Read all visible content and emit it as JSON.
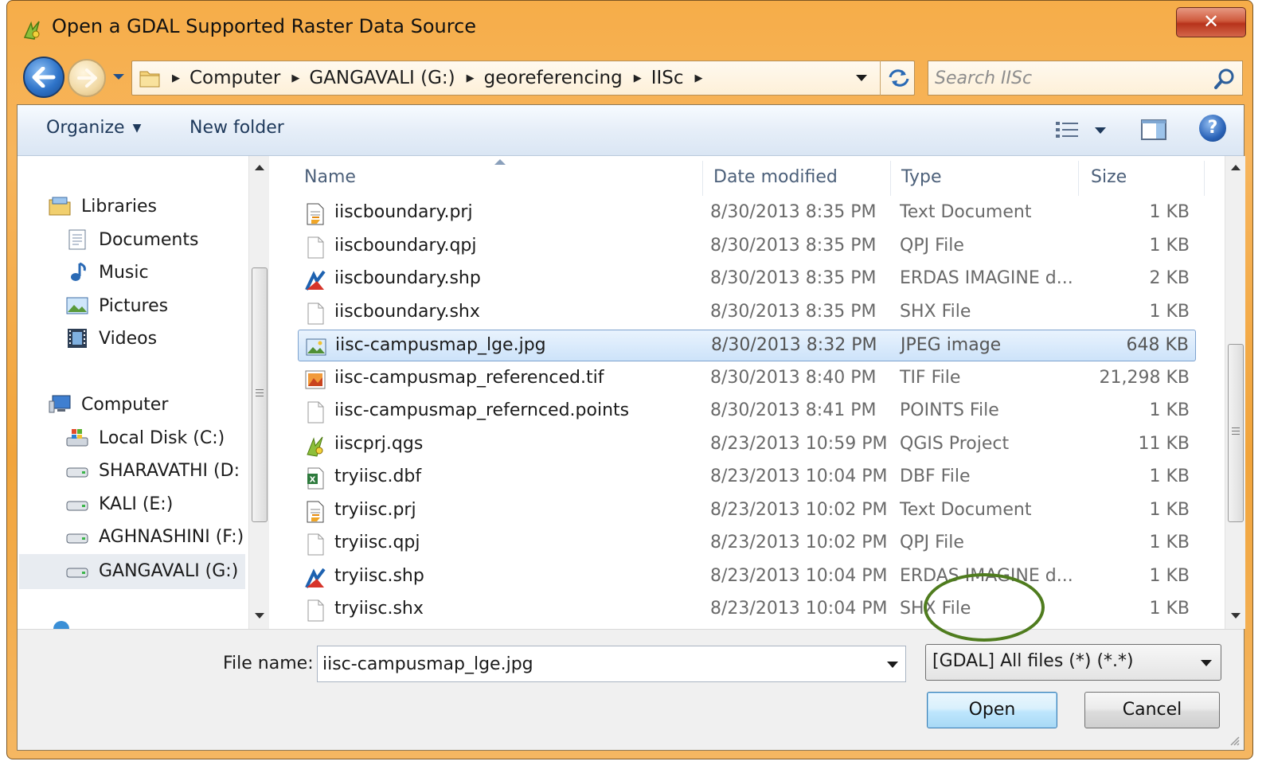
{
  "window": {
    "title": "Open a GDAL Supported Raster Data Source",
    "close_label": "✕"
  },
  "address": {
    "crumbs": [
      "Computer",
      "GANGAVALI (G:)",
      "georeferencing",
      "IISc"
    ]
  },
  "search": {
    "placeholder": "Search IISc"
  },
  "toolbar": {
    "organize_label": "Organize",
    "new_folder_label": "New folder",
    "help_label": "?"
  },
  "navpane": {
    "libraries_label": "Libraries",
    "libraries": [
      "Documents",
      "Music",
      "Pictures",
      "Videos"
    ],
    "computer_label": "Computer",
    "drives": [
      "Local Disk (C:)",
      "SHARAVATHI (D:",
      "KALI (E:)",
      "AGHNASHINI (F:)",
      "GANGAVALI (G:)"
    ],
    "selected": "GANGAVALI (G:)"
  },
  "columns": {
    "name": "Name",
    "date": "Date modified",
    "type": "Type",
    "size": "Size"
  },
  "files": [
    {
      "name": "iiscboundary.prj",
      "date": "8/30/2013 8:35 PM",
      "type": "Text Document",
      "size": "1 KB",
      "icon": "text-doc-icon"
    },
    {
      "name": "iiscboundary.qpj",
      "date": "8/30/2013 8:35 PM",
      "type": "QPJ File",
      "size": "1 KB",
      "icon": "blank-file-icon"
    },
    {
      "name": "iiscboundary.shp",
      "date": "8/30/2013 8:35 PM",
      "type": "ERDAS IMAGINE d...",
      "size": "2 KB",
      "icon": "erdas-icon"
    },
    {
      "name": "iiscboundary.shx",
      "date": "8/30/2013 8:35 PM",
      "type": "SHX File",
      "size": "1 KB",
      "icon": "blank-file-icon"
    },
    {
      "name": "iisc-campusmap_lge.jpg",
      "date": "8/30/2013 8:32 PM",
      "type": "JPEG image",
      "size": "648 KB",
      "icon": "image-file-icon",
      "selected": true
    },
    {
      "name": "iisc-campusmap_referenced.tif",
      "date": "8/30/2013 8:40 PM",
      "type": "TIF File",
      "size": "21,298 KB",
      "icon": "tif-file-icon"
    },
    {
      "name": "iisc-campusmap_refernced.points",
      "date": "8/30/2013 8:41 PM",
      "type": "POINTS File",
      "size": "1 KB",
      "icon": "blank-file-icon"
    },
    {
      "name": "iiscprj.qgs",
      "date": "8/23/2013 10:59 PM",
      "type": "QGIS Project",
      "size": "11 KB",
      "icon": "qgis-icon"
    },
    {
      "name": "tryiisc.dbf",
      "date": "8/23/2013 10:04 PM",
      "type": "DBF File",
      "size": "1 KB",
      "icon": "excel-icon"
    },
    {
      "name": "tryiisc.prj",
      "date": "8/23/2013 10:02 PM",
      "type": "Text Document",
      "size": "1 KB",
      "icon": "text-doc-icon"
    },
    {
      "name": "tryiisc.qpj",
      "date": "8/23/2013 10:02 PM",
      "type": "QPJ File",
      "size": "1 KB",
      "icon": "blank-file-icon"
    },
    {
      "name": "tryiisc.shp",
      "date": "8/23/2013 10:04 PM",
      "type": "ERDAS IMAGINE d...",
      "size": "1 KB",
      "icon": "erdas-icon"
    },
    {
      "name": "tryiisc.shx",
      "date": "8/23/2013 10:04 PM",
      "type": "SHX File",
      "size": "1 KB",
      "icon": "blank-file-icon"
    }
  ],
  "bottom": {
    "file_name_label": "File name:",
    "file_name_value": "iisc-campusmap_lge.jpg",
    "filter_value": "[GDAL] All files (*) (*.*)",
    "open_label": "Open",
    "cancel_label": "Cancel"
  },
  "colors": {
    "frame": "#f5ae4c",
    "selection": "#cde3fa",
    "highlight_ring": "#4f7c1e"
  }
}
